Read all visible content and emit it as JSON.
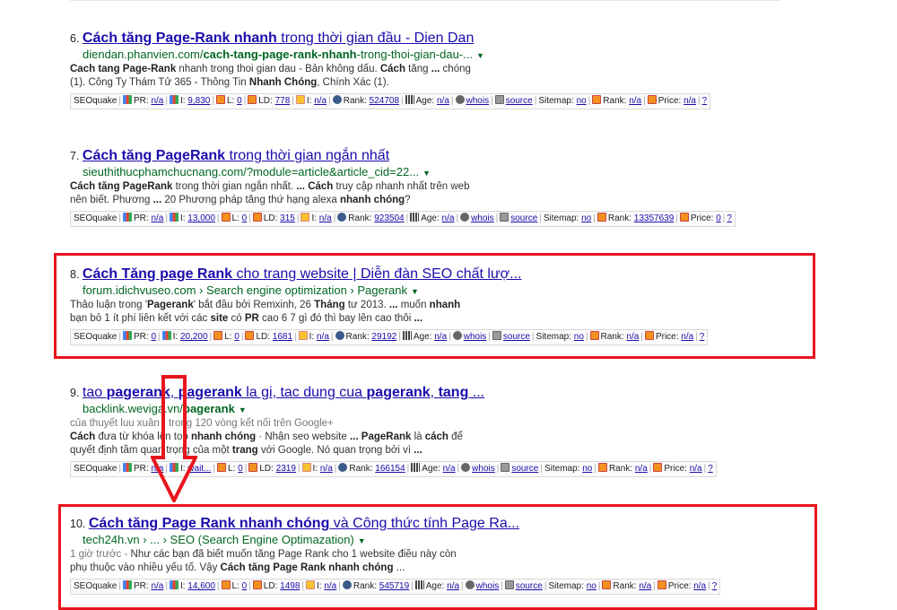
{
  "results": [
    {
      "num": "6.",
      "title_parts": [
        {
          "t": "Cách tăng Page-Rank nhanh",
          "b": true
        },
        {
          "t": " trong thời gian đầu - Dien Dan",
          "b": false
        }
      ],
      "url_parts": [
        {
          "t": "diendan.phanvien.com/",
          "b": false
        },
        {
          "t": "cach-tang-page-rank-nhanh",
          "b": true
        },
        {
          "t": "-trong-thoi-gian-dau-...",
          "b": false
        }
      ],
      "snippet_lines": [
        [
          {
            "t": "Cach tang Page-Rank",
            "b": true
          },
          {
            "t": " nhanh trong thoi gian dau - Bản không dấu. ",
            "b": false
          },
          {
            "t": "Cách",
            "b": true
          },
          {
            "t": " tăng ",
            "b": false
          },
          {
            "t": "...",
            "b": true
          },
          {
            "t": " chóng",
            "b": false
          }
        ],
        [
          {
            "t": "(1). Công Ty Thám Tử 365 - Thông Tin ",
            "b": false
          },
          {
            "t": "Nhanh Chóng",
            "b": true
          },
          {
            "t": ", Chính Xác (1).",
            "b": false
          }
        ]
      ],
      "seo": {
        "pr": "n/a",
        "i": "9,830",
        "l": "0",
        "ld": "778",
        "i2": "n/a",
        "rank": "524708",
        "age": "n/a",
        "whois": "whois",
        "source": "source",
        "sitemap": "no",
        "rank2": "n/a",
        "price": "n/a",
        "q": "?"
      }
    },
    {
      "num": "7.",
      "title_parts": [
        {
          "t": "Cách tăng PageRank",
          "b": true
        },
        {
          "t": " trong thời gian ngắn nhất",
          "b": false
        }
      ],
      "url_parts": [
        {
          "t": "sieuthithucphamchucnang.com/?module=article&article_cid=22...",
          "b": false
        }
      ],
      "snippet_lines": [
        [
          {
            "t": "Cách tăng PageRank",
            "b": true
          },
          {
            "t": " trong thời gian ngắn nhất. ",
            "b": false
          },
          {
            "t": "...",
            "b": true
          },
          {
            "t": " ",
            "b": false
          },
          {
            "t": "Cách",
            "b": true
          },
          {
            "t": " truy cập nhanh nhất trên web",
            "b": false
          }
        ],
        [
          {
            "t": "nên biết. Phương ",
            "b": false
          },
          {
            "t": "...",
            "b": true
          },
          {
            "t": " 20 Phương pháp tăng thứ hạng alexa ",
            "b": false
          },
          {
            "t": "nhanh chóng",
            "b": true
          },
          {
            "t": "?",
            "b": false
          }
        ]
      ],
      "seo": {
        "pr": "n/a",
        "i": "13,000",
        "l": "0",
        "ld": "315",
        "i2": "n/a",
        "rank": "923504",
        "age": "n/a",
        "whois": "whois",
        "source": "source",
        "sitemap": "no",
        "rank2": "13357639",
        "price": "0",
        "q": "?"
      }
    },
    {
      "num": "8.",
      "title_parts": [
        {
          "t": "Cách Tăng page Rank",
          "b": true
        },
        {
          "t": " cho trang website | Diễn đàn SEO chất lượ...",
          "b": false
        }
      ],
      "url_parts": [
        {
          "t": "forum.idichvuseo.com › Search engine optimization › Pagerank",
          "b": false
        }
      ],
      "snippet_lines": [
        [
          {
            "t": "Thảo luận trong '",
            "b": false
          },
          {
            "t": "Pagerank",
            "b": true
          },
          {
            "t": "' bắt đầu bởi Remxinh, 26 ",
            "b": false
          },
          {
            "t": "Tháng",
            "b": true
          },
          {
            "t": " tư 2013. ",
            "b": false
          },
          {
            "t": "...",
            "b": true
          },
          {
            "t": " muốn ",
            "b": false
          },
          {
            "t": "nhanh",
            "b": true
          }
        ],
        [
          {
            "t": "bạn bỏ 1 ít phí liên kết với các ",
            "b": false
          },
          {
            "t": "site",
            "b": true
          },
          {
            "t": " có ",
            "b": false
          },
          {
            "t": "PR",
            "b": true
          },
          {
            "t": " cao 6 7 gì đó thì bay lên cao thôi ",
            "b": false
          },
          {
            "t": "...",
            "b": true
          }
        ]
      ],
      "seo": {
        "pr": "0",
        "i": "20,200",
        "l": "0",
        "ld": "1681",
        "i2": "n/a",
        "rank": "29192",
        "age": "n/a",
        "whois": "whois",
        "source": "source",
        "sitemap": "no",
        "rank2": "n/a",
        "price": "n/a",
        "q": "?"
      }
    },
    {
      "num": "9.",
      "title_parts": [
        {
          "t": "tao ",
          "b": false
        },
        {
          "t": "pagerank",
          "b": true
        },
        {
          "t": ", ",
          "b": false
        },
        {
          "t": "pagerank",
          "b": true
        },
        {
          "t": " la gi, tac dung cua ",
          "b": false
        },
        {
          "t": "pagerank",
          "b": true
        },
        {
          "t": ", ",
          "b": false
        },
        {
          "t": "tang",
          "b": true
        },
        {
          "t": " ...",
          "b": false
        }
      ],
      "url_parts": [
        {
          "t": "backlink.weviga.vn/",
          "b": false
        },
        {
          "t": "pagerank",
          "b": true
        }
      ],
      "snippet_lines": [
        [
          {
            "t": "của thuyết luu xuân - trong 120 vòng kết nối trên Google+",
            "b": false,
            "m": true
          }
        ],
        [
          {
            "t": "Cách",
            "b": true
          },
          {
            "t": " đưa từ khóa lên top ",
            "b": false
          },
          {
            "t": "nhanh chóng",
            "b": true
          },
          {
            "t": " · Nhận seo website ",
            "b": false
          },
          {
            "t": "...",
            "b": true
          },
          {
            "t": " ",
            "b": false
          },
          {
            "t": "PageRank",
            "b": true
          },
          {
            "t": " là ",
            "b": false
          },
          {
            "t": "cách",
            "b": true
          },
          {
            "t": " để",
            "b": false
          }
        ],
        [
          {
            "t": "quyết định tầm quan trọng của một ",
            "b": false
          },
          {
            "t": "trang",
            "b": true
          },
          {
            "t": " với Google. Nó quan trọng bởi vì ",
            "b": false
          },
          {
            "t": "...",
            "b": true
          }
        ]
      ],
      "seo": {
        "pr": "n/a",
        "i": "wait...",
        "l": "0",
        "ld": "2319",
        "i2": "n/a",
        "rank": "166154",
        "age": "n/a",
        "whois": "whois",
        "source": "source",
        "sitemap": "no",
        "rank2": "n/a",
        "price": "n/a",
        "q": "?"
      }
    },
    {
      "num": "10.",
      "title_parts": [
        {
          "t": "Cách tăng Page Rank nhanh chóng",
          "b": true
        },
        {
          "t": " và Công thức tính Page Ra...",
          "b": false
        }
      ],
      "url_parts": [
        {
          "t": "tech24h.vn › ... › SEO (Search Engine Optimazation)",
          "b": false
        }
      ],
      "snippet_lines": [
        [
          {
            "t": "1 giờ trước - ",
            "b": false,
            "m": true
          },
          {
            "t": "Như các bạn đã biết muốn tăng Page Rank cho 1 website điều này còn",
            "b": false
          }
        ],
        [
          {
            "t": "phụ thuộc vào nhiều yếu tố. Vậy ",
            "b": false
          },
          {
            "t": "Cách tăng Page Rank nhanh chóng",
            "b": true
          },
          {
            "t": " ...",
            "b": false
          }
        ]
      ],
      "seo": {
        "pr": "n/a",
        "i": "14,600",
        "l": "0",
        "ld": "1498",
        "i2": "n/a",
        "rank": "545719",
        "age": "n/a",
        "whois": "whois",
        "source": "source",
        "sitemap": "no",
        "rank2": "n/a",
        "price": "n/a",
        "q": "?"
      }
    }
  ],
  "seo_labels": {
    "brand": "SEOquake",
    "pr": "PR:",
    "i": "I:",
    "l": "L:",
    "ld": "LD:",
    "i2": "I:",
    "rank": "Rank:",
    "age": "Age:",
    "sitemap": "Sitemap:",
    "rank2": "Rank:",
    "price": "Price:"
  },
  "colors": {
    "highlight": "#e8141d",
    "link": "#1a0dab",
    "url": "#006621"
  }
}
